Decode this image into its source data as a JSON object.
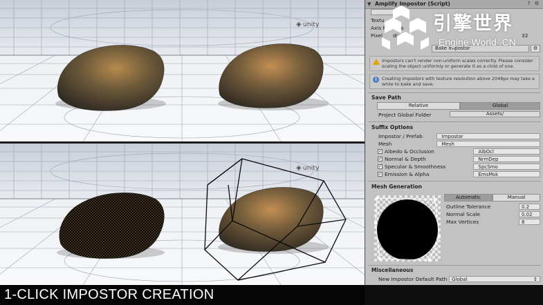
{
  "viewports": {
    "unity_watermark": "unity"
  },
  "caption": "1-CLICK IMPOSTOR CREATION",
  "logo": {
    "chinese": "引擎世界",
    "english": "Engine World .CN"
  },
  "inspector": {
    "title": "Amplify Impostor (Script)",
    "truncated_rows": [
      "Textu",
      "Axis F",
      "Pixel"
    ],
    "truncated_suffixes": [
      "mes",
      "ding"
    ],
    "slider_value": "32",
    "bake_button": "Bake Impostor",
    "warning_text": "Impostors can't render non-uniform scales correctly. Please consider scaling the object uniformly or generate it as a child of one.",
    "info_text": "Creating impostors with texture resolution above 2048px may take a while to bake and save.",
    "save_path": {
      "header": "Save Path",
      "relative": "Relative",
      "global": "Global",
      "folder_label": "Project Global Folder",
      "folder_value": "Assets/"
    },
    "suffix_options": {
      "header": "Suffix Options",
      "fields": [
        {
          "label": "Impostor / Prefab",
          "value": "_Impostor"
        },
        {
          "label": "Mesh",
          "value": "_Mesh"
        }
      ],
      "checks": [
        {
          "label": "Albedo & Occlusion",
          "value": "_AlbOcl"
        },
        {
          "label": "Normal & Depth",
          "value": "_NrmDep"
        },
        {
          "label": "Specular & Smoothness",
          "value": "_SpcSmo"
        },
        {
          "label": "Emission & Alpha",
          "value": "_EmsMsk"
        }
      ]
    },
    "mesh_generation": {
      "header": "Mesh Generation",
      "automatic": "Automatic",
      "manual": "Manual",
      "params": [
        {
          "label": "Outline Tolerance",
          "value": "0.2"
        },
        {
          "label": "Normal Scale",
          "value": "0.02"
        },
        {
          "label": "Max Vertices",
          "value": "8"
        }
      ]
    },
    "misc": {
      "header": "Miscellaneous",
      "label": "New Impostor Default Path",
      "value": "Global"
    }
  }
}
